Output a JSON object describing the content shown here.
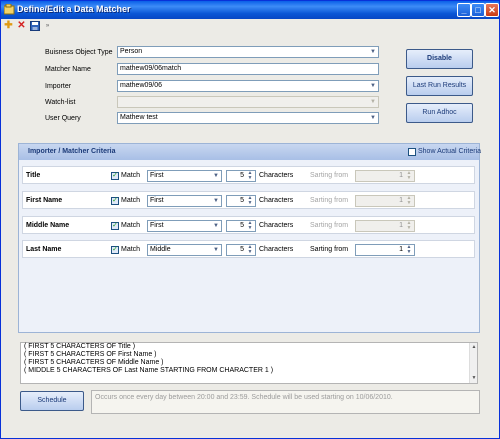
{
  "window": {
    "title": "Define/Edit a Data Matcher",
    "controls": {
      "minimize": "_",
      "maximize": "□",
      "close": "✕"
    }
  },
  "toolbar": {
    "icons": [
      "add-icon",
      "delete-icon",
      "save-icon"
    ]
  },
  "form": {
    "business_object_type": {
      "label": "Buisness Object Type",
      "value": "Person"
    },
    "matcher_name": {
      "label": "Matcher Name",
      "value": "mathew09/06match"
    },
    "importer": {
      "label": "Importer",
      "value": "mathew09/06"
    },
    "watch_list": {
      "label": "Watch-list",
      "value": ""
    },
    "user_query": {
      "label": "User Query",
      "value": "Mathew test"
    }
  },
  "actions": {
    "disable": "Disable",
    "last_run_results": "Last Run Results",
    "run_adhoc": "Run Adhoc",
    "schedule": "Schedule"
  },
  "criteria": {
    "title": "Importer / Matcher Criteria",
    "show_actual_criteria": {
      "label": "Show Actual Criteria",
      "checked": false
    },
    "rows": [
      {
        "field": "Title",
        "match": true,
        "match_label": "Match",
        "mode": "First",
        "count": "5",
        "count_label": "Characters",
        "starting_label": "Sarting from",
        "starting_value": "1",
        "starting_enabled": false
      },
      {
        "field": "First Name",
        "match": true,
        "match_label": "Match",
        "mode": "First",
        "count": "5",
        "count_label": "Characters",
        "starting_label": "Sarting from",
        "starting_value": "1",
        "starting_enabled": false
      },
      {
        "field": "Middle Name",
        "match": true,
        "match_label": "Match",
        "mode": "First",
        "count": "5",
        "count_label": "Characters",
        "starting_label": "Sarting from",
        "starting_value": "1",
        "starting_enabled": false
      },
      {
        "field": "Last Name",
        "match": true,
        "match_label": "Match",
        "mode": "Middle",
        "count": "5",
        "count_label": "Characters",
        "starting_label": "Sarting from",
        "starting_value": "1",
        "starting_enabled": true
      }
    ]
  },
  "summary_lines": [
    "( FIRST 5 CHARACTERS OF Title )",
    "( FIRST 5 CHARACTERS OF First Name )",
    "( FIRST 5 CHARACTERS OF Middle Name )",
    "( MIDDLE 5 CHARACTERS OF Last Name STARTING FROM CHARACTER 1 )"
  ],
  "schedule_text": "Occurs once every day between 20:00 and 23:59. Schedule will be used starting on 10/06/2010.",
  "colors": {
    "title_bar": "#0a5fe8",
    "panel_header": "#a8bfe6",
    "button_text": "#1b3a78"
  }
}
